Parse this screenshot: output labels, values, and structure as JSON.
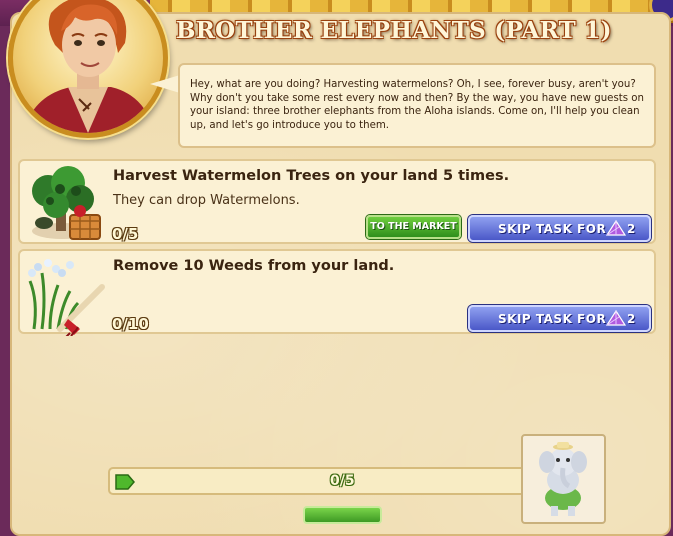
{
  "quest": {
    "title": "BROTHER ELEPHANTS (PART 1)",
    "dialog": "Hey, what are you doing? Harvesting watermelons? Oh, I see, forever busy, aren't you? Why don't you take some rest every now and then? By the way, you have new guests on your island: three brother elephants from the Aloha islands. Come on, I'll help you clean up, and let's go introduce you to them."
  },
  "tasks": [
    {
      "title": "Harvest Watermelon Trees on your land 5 times.",
      "description": "They can drop Watermelons.",
      "progress": "0/5",
      "market_label": "TO THE MARKET",
      "skip_label": "SKIP TASK FOR",
      "skip_cost": "2"
    },
    {
      "title": "Remove 10 Weeds from your land.",
      "description": "",
      "progress": "0/10",
      "skip_label": "SKIP TASK FOR",
      "skip_cost": "2"
    }
  ],
  "reward": {
    "progress": "0/5"
  },
  "colors": {
    "panel": "#f0ddb0",
    "frame": "#6b2a5a",
    "skip_button": "#5b6ad6",
    "market_button": "#3fa326",
    "gem": "#9b46c8"
  },
  "icons": {
    "task1": "watermelon-tree-icon",
    "task2": "weeds-rake-icon",
    "gem": "crystal-gem-icon",
    "bar": "green-arrow-icon",
    "reward": "elephant-icon"
  }
}
